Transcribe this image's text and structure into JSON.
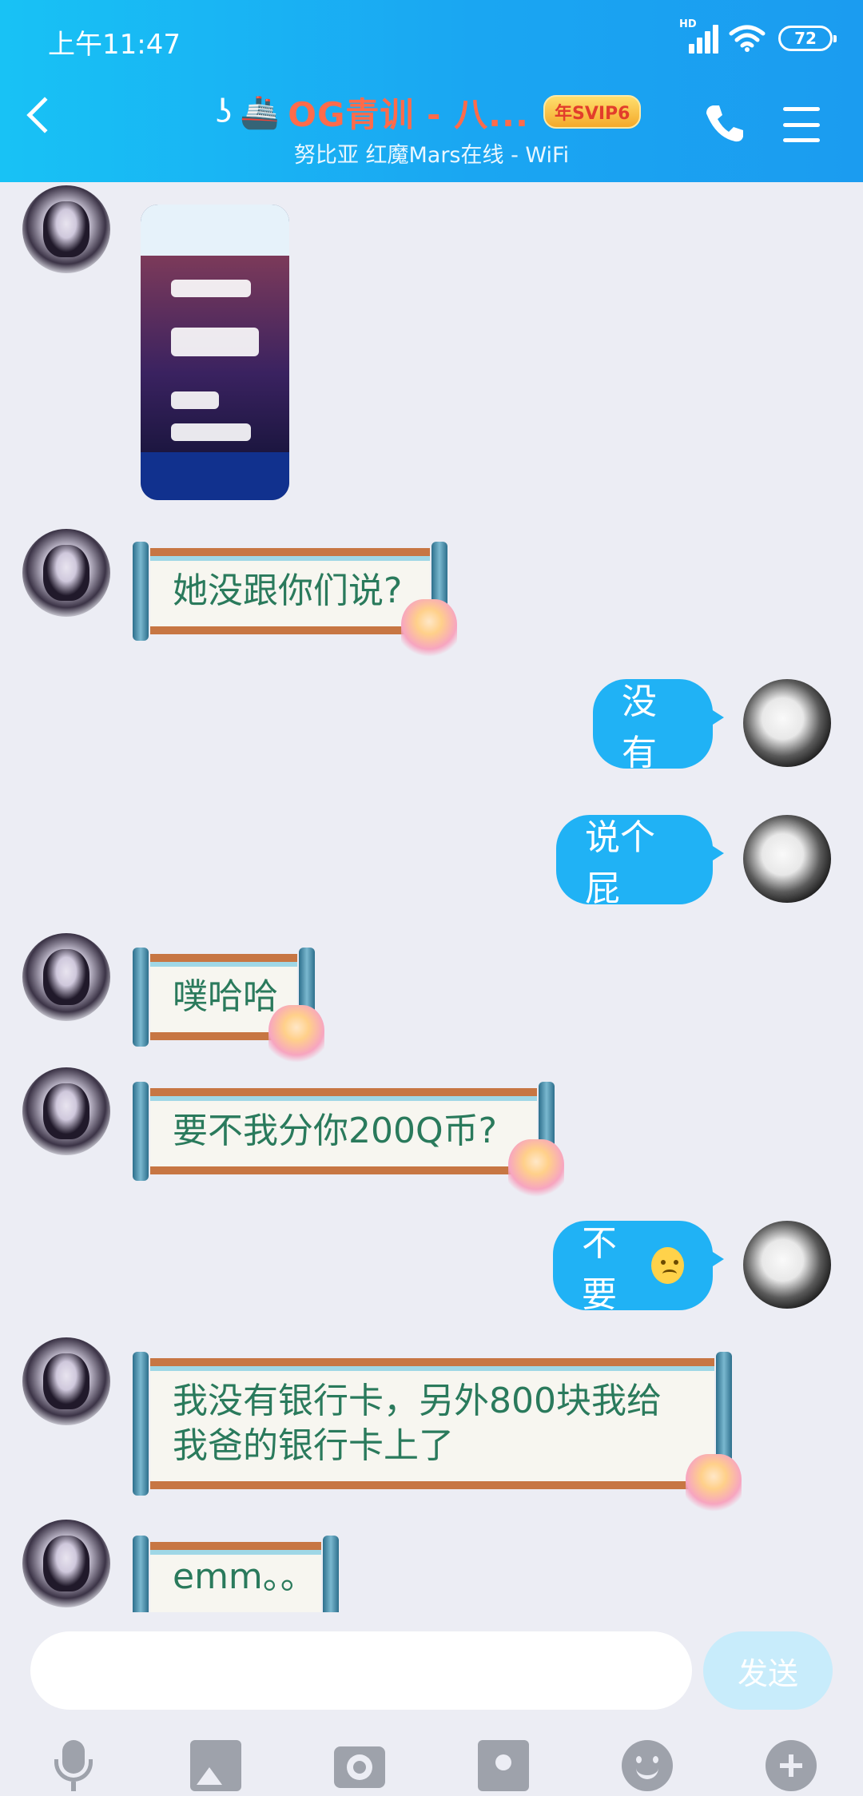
{
  "status": {
    "time": "上午11:47",
    "hd": "HD",
    "battery": "72"
  },
  "header": {
    "title": "OG青训 - 八...",
    "ship": "🚢",
    "svip_badge": "年SVIP6",
    "subtitle": "努比亚 红魔Mars在线 - WiFi"
  },
  "messages": [
    {
      "id": "m1",
      "side": "left",
      "type": "image",
      "alt": "screenshot"
    },
    {
      "id": "m2",
      "side": "left",
      "text": "她没跟你们说?"
    },
    {
      "id": "m3",
      "side": "right",
      "text": "没有"
    },
    {
      "id": "m4",
      "side": "right",
      "text": "说个屁"
    },
    {
      "id": "m5",
      "side": "left",
      "text": "噗哈哈"
    },
    {
      "id": "m6",
      "side": "left",
      "text": "要不我分你200Q币?"
    },
    {
      "id": "m7",
      "side": "right",
      "text": "不要"
    },
    {
      "id": "m8",
      "side": "left",
      "text": "我没有银行卡，另外800块我给"
    },
    {
      "id": "m8b",
      "side": "left",
      "text": "我爸的银行卡上了"
    },
    {
      "id": "m9",
      "side": "left",
      "text": "emm。。"
    }
  ],
  "composer": {
    "input_value": "",
    "send_label": "发送"
  },
  "toolbar": [
    "microphone-icon",
    "image-icon",
    "camera-icon",
    "red-packet-icon",
    "emoji-icon",
    "plus-icon"
  ],
  "colors": {
    "header": "#1aa6f2",
    "bubble_right": "#20b2f5",
    "scroll_text": "#2a7a5c",
    "bg": "#ecedf4"
  }
}
